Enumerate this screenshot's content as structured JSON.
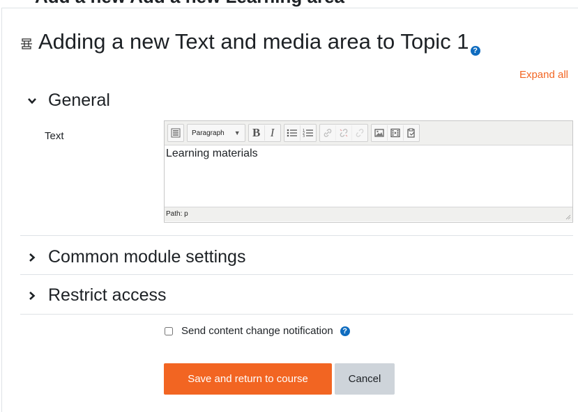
{
  "top_fragment": "Add a new Add a new Learning area",
  "page": {
    "title": "Adding a new Text and media area to Topic 1",
    "help_glyph": "?",
    "expand_all": "Expand all"
  },
  "sections": {
    "general": {
      "label": "General",
      "expanded": true
    },
    "common_module": {
      "label": "Common module settings",
      "expanded": false
    },
    "restrict_access": {
      "label": "Restrict access",
      "expanded": false
    }
  },
  "form": {
    "text_label": "Text",
    "editor": {
      "block_format": "Paragraph",
      "bold": "B",
      "italic": "I",
      "content": "Learning materials",
      "path": "Path: p"
    },
    "notify_label": "Send content change notification",
    "notify_checked": false
  },
  "buttons": {
    "save": "Save and return to course",
    "cancel": "Cancel"
  },
  "colors": {
    "accent": "#f26522",
    "help_icon": "#0f6cbf",
    "secondary_button": "#ced4da"
  }
}
